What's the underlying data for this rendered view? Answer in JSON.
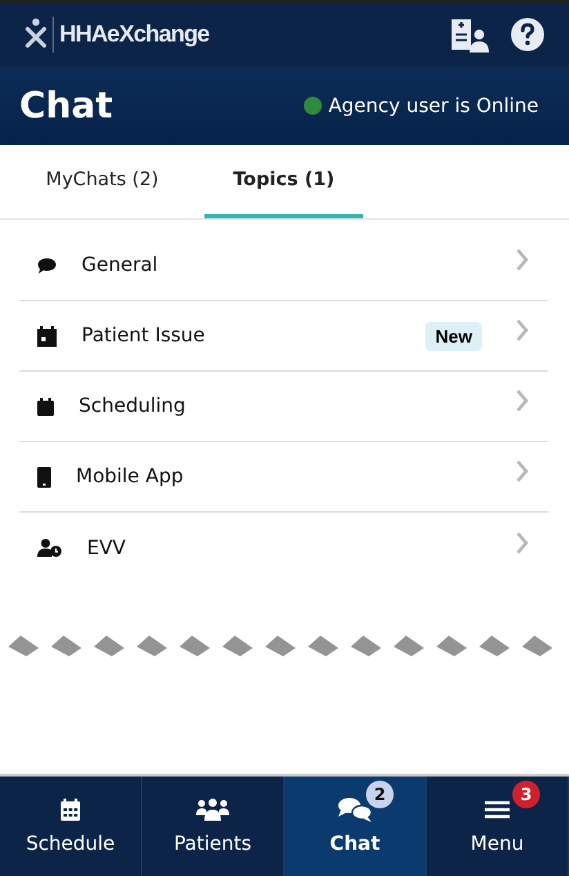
{
  "header": {
    "logo": "HHAeXchange"
  },
  "title_bar": {
    "title": "Chat",
    "status": {
      "online": true,
      "text": "Agency user is Online"
    }
  },
  "tabs": [
    {
      "label": "MyChats (2)",
      "selected": false
    },
    {
      "label": "Topics (1)",
      "selected": true
    }
  ],
  "topics": [
    {
      "label": "General"
    },
    {
      "label": "Patient Issue",
      "badge": "New"
    },
    {
      "label": "Scheduling"
    },
    {
      "label": "Mobile App"
    },
    {
      "label": "EVV"
    }
  ],
  "bottom_nav": [
    {
      "label": "Schedule",
      "selected": false
    },
    {
      "label": "Patients",
      "selected": false
    },
    {
      "label": "Chat",
      "selected": true,
      "badge": {
        "text": "2",
        "color": "#c8d3ee"
      }
    },
    {
      "label": "Menu",
      "selected": false,
      "badge": {
        "text": "3",
        "color": "#d0202e"
      }
    }
  ]
}
